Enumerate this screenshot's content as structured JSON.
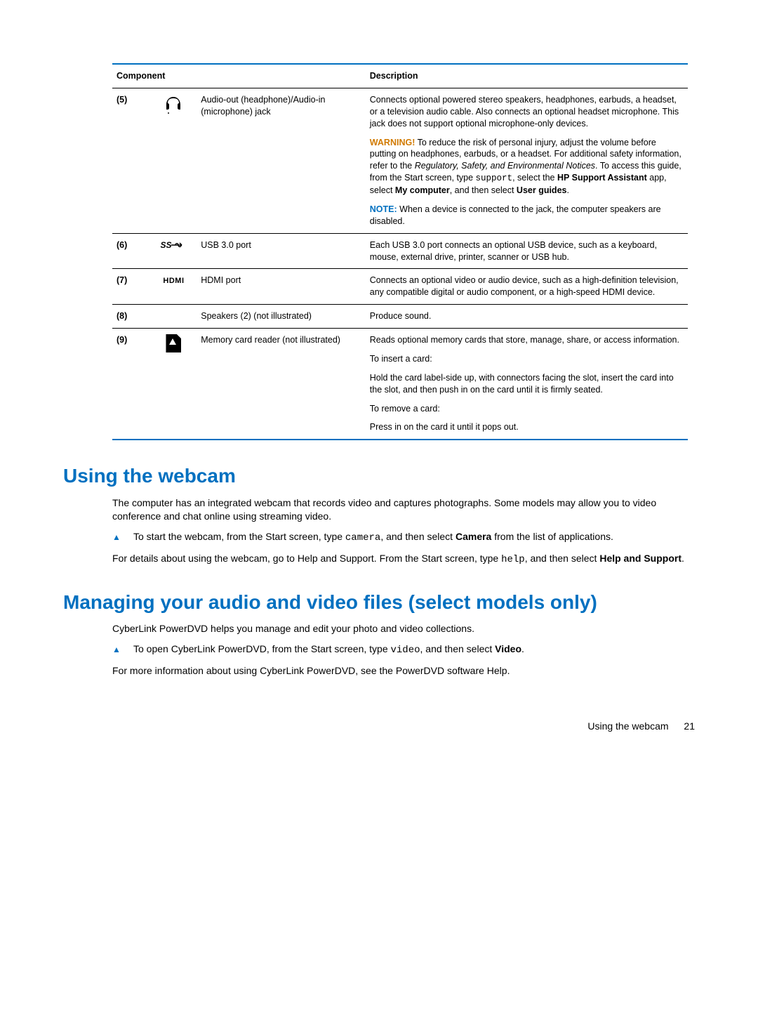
{
  "table": {
    "headers": {
      "component": "Component",
      "description": "Description"
    },
    "rows": [
      {
        "num": "(5)",
        "icon": "headphone-icon",
        "component": "Audio-out (headphone)/Audio-in (microphone) jack",
        "desc_main": "Connects optional powered stereo speakers, headphones, earbuds, a headset, or a television audio cable. Also connects an optional headset microphone. This jack does not support optional microphone-only devices.",
        "warn_label": "WARNING!",
        "warn_text_1": "   To reduce the risk of personal injury, adjust the volume before putting on headphones, earbuds, or a headset. For additional safety information, refer to the ",
        "warn_italic": "Regulatory, Safety, and Environmental Notices",
        "warn_text_2": ". To access this guide, from the Start screen, type ",
        "warn_mono": "support",
        "warn_text_3": ", select the ",
        "warn_bold1": "HP Support Assistant",
        "warn_text_4": " app, select ",
        "warn_bold2": "My computer",
        "warn_text_5": ", and then select ",
        "warn_bold3": "User guides",
        "warn_text_6": ".",
        "note_label": "NOTE:",
        "note_text": "   When a device is connected to the jack, the computer speakers are disabled."
      },
      {
        "num": "(6)",
        "icon": "usb-ss-icon",
        "component": "USB 3.0 port",
        "desc_main": "Each USB 3.0 port connects an optional USB device, such as a keyboard, mouse, external drive, printer, scanner or USB hub."
      },
      {
        "num": "(7)",
        "icon": "hdmi-icon",
        "component": "HDMI port",
        "desc_main": "Connects an optional video or audio device, such as a high-definition television, any compatible digital or audio component, or a high-speed HDMI device."
      },
      {
        "num": "(8)",
        "icon": "",
        "component": "Speakers (2) (not illustrated)",
        "desc_main": "Produce sound."
      },
      {
        "num": "(9)",
        "icon": "sdcard-icon",
        "component": "Memory card reader (not illustrated)",
        "desc_main": "Reads optional memory cards that store, manage, share, or access information.",
        "p2": "To insert a card:",
        "p3": "Hold the card label-side up, with connectors facing the slot, insert the card into the slot, and then push in on the card until it is firmly seated.",
        "p4": "To remove a card:",
        "p5": "Press in on the card it until it pops out."
      }
    ]
  },
  "section1": {
    "heading": "Using the webcam",
    "p1": "The computer has an integrated webcam that records video and captures photographs. Some models may allow you to video conference and chat online using streaming video.",
    "bullet_pre": "To start the webcam, from the Start screen, type ",
    "bullet_mono": "camera",
    "bullet_mid": ", and then select ",
    "bullet_bold": "Camera",
    "bullet_post": " from the list of applications.",
    "p2_pre": "For details about using the webcam, go to Help and Support. From the Start screen, type ",
    "p2_mono": "help",
    "p2_mid": ", and then select ",
    "p2_bold": "Help and Support",
    "p2_post": "."
  },
  "section2": {
    "heading": "Managing your audio and video files (select models only)",
    "p1": "CyberLink PowerDVD helps you manage and edit your photo and video collections.",
    "bullet_pre": "To open CyberLink PowerDVD, from the Start screen, type ",
    "bullet_mono": "video",
    "bullet_mid": ", and then select ",
    "bullet_bold": "Video",
    "bullet_post": ".",
    "p2": "For more information about using CyberLink PowerDVD, see the PowerDVD software Help."
  },
  "footer": {
    "text": "Using the webcam",
    "page": "21"
  }
}
